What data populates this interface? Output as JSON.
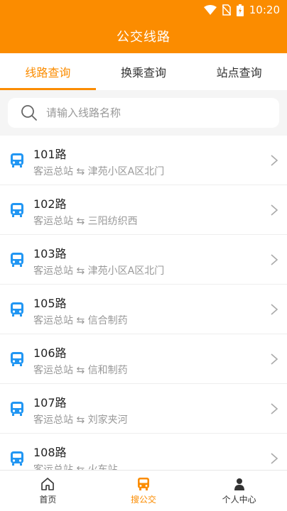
{
  "status_bar": {
    "time": "10:20"
  },
  "header": {
    "title": "公交线路"
  },
  "tabs": [
    {
      "label": "线路查询",
      "active": true
    },
    {
      "label": "换乘查询",
      "active": false
    },
    {
      "label": "站点查询",
      "active": false
    }
  ],
  "search": {
    "placeholder": "请输入线路名称",
    "value": ""
  },
  "routes": [
    {
      "name": "101路",
      "from": "客运总站",
      "to": "津苑小区A区北门"
    },
    {
      "name": "102路",
      "from": "客运总站",
      "to": "三阳纺织西"
    },
    {
      "name": "103路",
      "from": "客运总站",
      "to": "津苑小区A区北门"
    },
    {
      "name": "105路",
      "from": "客运总站",
      "to": "信合制药"
    },
    {
      "name": "106路",
      "from": "客运总站",
      "to": "信和制药"
    },
    {
      "name": "107路",
      "from": "客运总站",
      "to": "刘家夹河"
    },
    {
      "name": "108路",
      "from": "客运总站",
      "to": "火车站"
    }
  ],
  "route_separator": "⇆",
  "bottom_nav": [
    {
      "label": "首页",
      "icon": "home-icon",
      "active": false
    },
    {
      "label": "搜公交",
      "icon": "bus-icon",
      "active": true
    },
    {
      "label": "个人中心",
      "icon": "person-icon",
      "active": false
    }
  ],
  "colors": {
    "accent": "#fb8c00",
    "bus_icon": "#2196f3"
  }
}
